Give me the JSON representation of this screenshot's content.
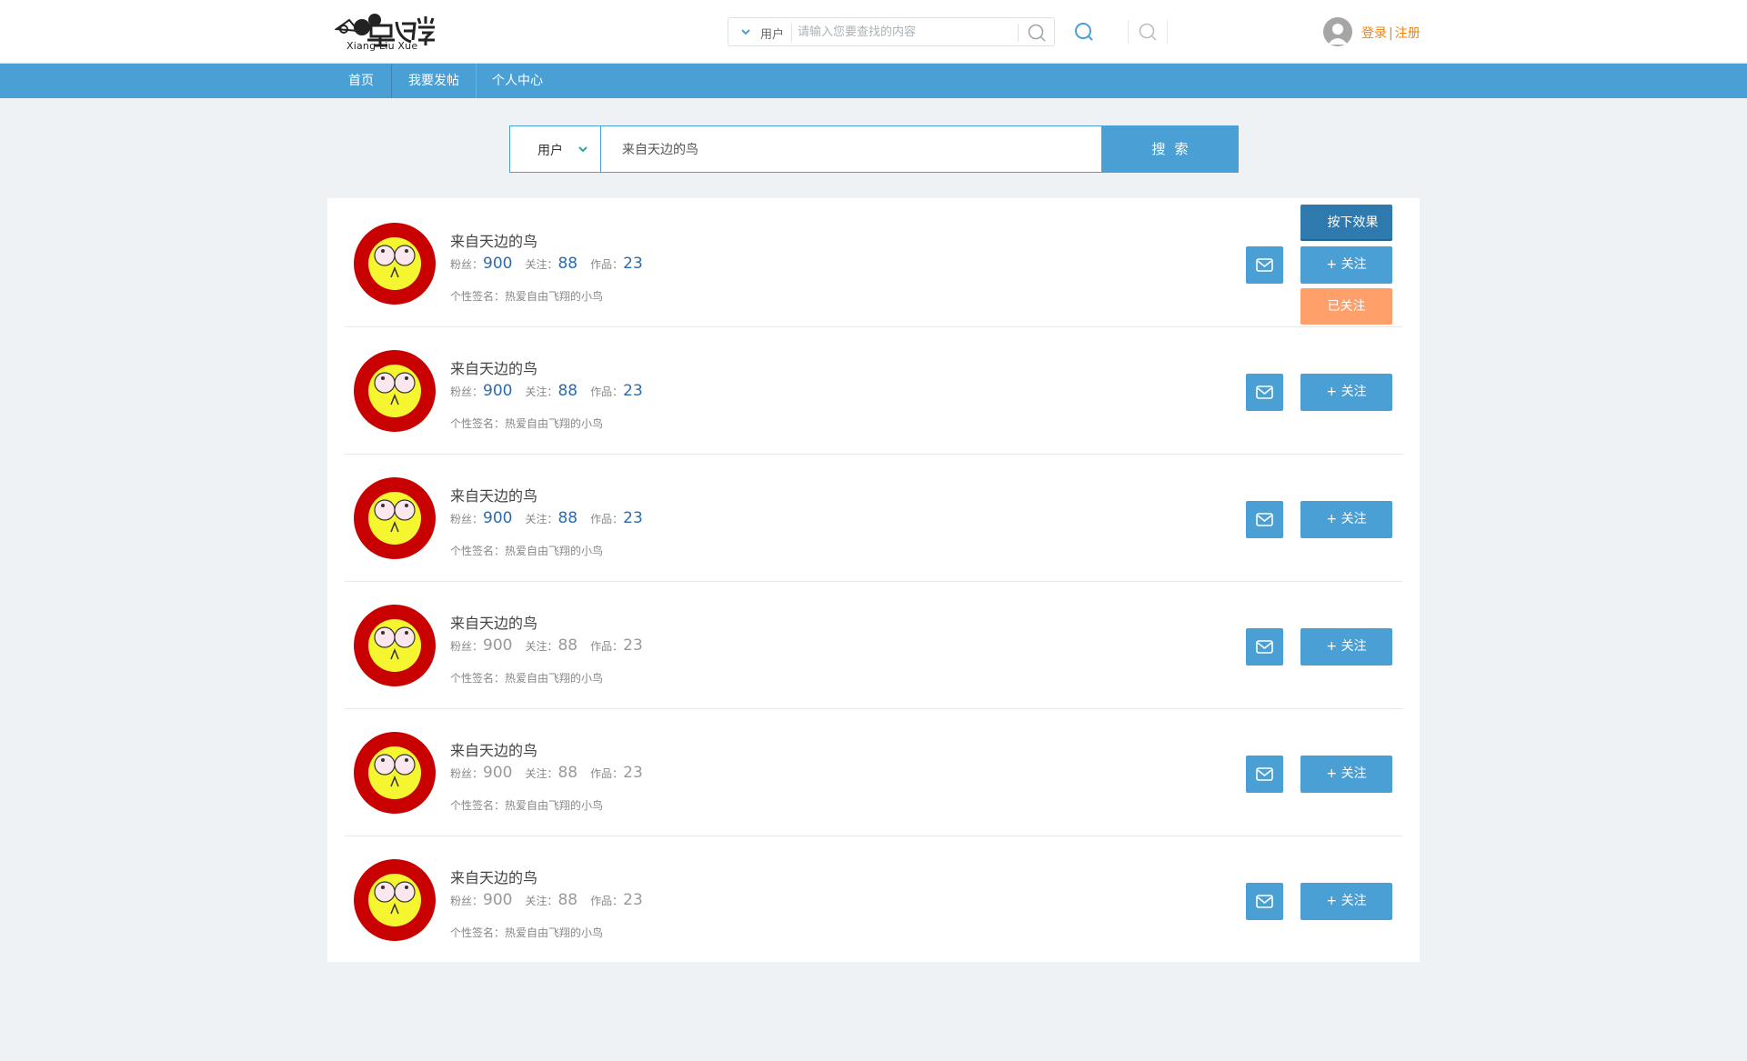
{
  "header": {
    "logo_text": "Xiang Liu Xue",
    "search_type": "用户",
    "search_placeholder": "请输入您要查找的内容",
    "login_label": "登录",
    "separator": "|",
    "register_label": "注册"
  },
  "nav": {
    "items": [
      {
        "label": "首页"
      },
      {
        "label": "我要发帖"
      },
      {
        "label": "个人中心"
      }
    ]
  },
  "search": {
    "type_label": "用户",
    "query": "来自天边的鸟",
    "button_label": "搜索"
  },
  "labels": {
    "fans": "粉丝：",
    "follows": "关注：",
    "works": "作品：",
    "signature_prefix": "个性签名：",
    "follow_button": "+ 关注",
    "pressed_button": "按下效果",
    "followed_button": "已关注"
  },
  "colors": {
    "primary": "#4a9fd5",
    "pressed": "#2e79ad",
    "followed": "#ff9f6a",
    "auth_link": "#f0830f",
    "stat_value": "#2a6cb3"
  },
  "results": [
    {
      "name": "来自天边的鸟",
      "fans": "900",
      "follows": "88",
      "works": "23",
      "signature": "热爱自由飞翔的小鸟"
    },
    {
      "name": "来自天边的鸟",
      "fans": "900",
      "follows": "88",
      "works": "23",
      "signature": "热爱自由飞翔的小鸟"
    },
    {
      "name": "来自天边的鸟",
      "fans": "900",
      "follows": "88",
      "works": "23",
      "signature": "热爱自由飞翔的小鸟"
    },
    {
      "name": "来自天边的鸟",
      "fans": "900",
      "follows": "88",
      "works": "23",
      "signature": "热爱自由飞翔的小鸟"
    },
    {
      "name": "来自天边的鸟",
      "fans": "900",
      "follows": "88",
      "works": "23",
      "signature": "热爱自由飞翔的小鸟"
    },
    {
      "name": "来自天边的鸟",
      "fans": "900",
      "follows": "88",
      "works": "23",
      "signature": "热爱自由飞翔的小鸟"
    }
  ],
  "icons": {
    "dropdown": "chevron-down-icon",
    "search": "search-icon",
    "mail": "mail-icon",
    "avatar": "user-avatar-icon",
    "result_avatar": "emoji-face-icon"
  }
}
